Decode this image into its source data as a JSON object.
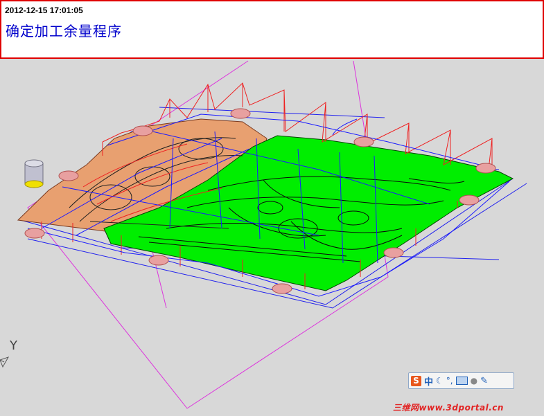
{
  "banner": {
    "timestamp": "2012-12-15 17:01:05",
    "title": "确定加工余量程序"
  },
  "viewport": {
    "axis_label": "Y"
  },
  "ime": {
    "logo": "S",
    "language": "中",
    "moon_icon": "crescent-moon-icon",
    "punct": "°,",
    "keyboard_icon": "keyboard-icon",
    "user_icon": "user-icon",
    "tool_icon": "wrench-icon"
  },
  "watermark": "三维网www.3dportal.cn",
  "colors": {
    "banner_border": "#e00000",
    "title_text": "#0000cc",
    "green_surface": "#00ee00",
    "peach_surface": "#e8a070",
    "wire_blue": "#1a1aff",
    "wire_red": "#ee2222",
    "wire_magenta": "#dd33dd",
    "pad_fill": "#e8a0a0"
  }
}
